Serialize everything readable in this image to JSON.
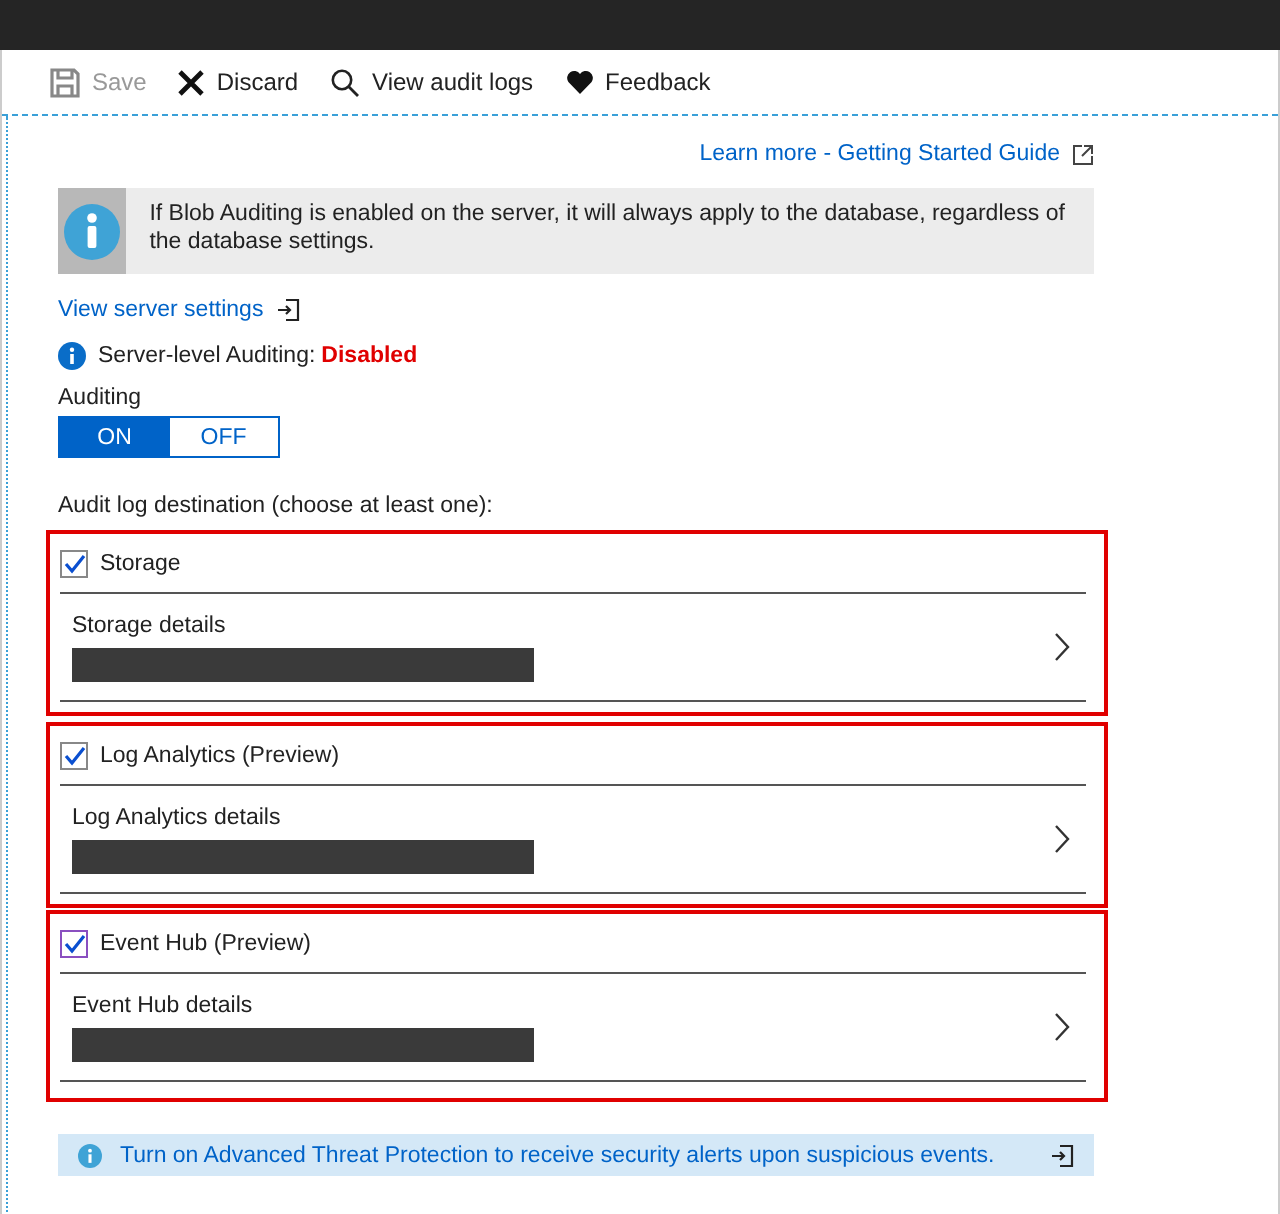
{
  "toolbar": [
    {
      "kind": "save",
      "label": "Save",
      "disabled": true
    },
    {
      "kind": "discard",
      "label": "Discard",
      "disabled": false
    },
    {
      "kind": "search",
      "label": "View audit logs",
      "disabled": false
    },
    {
      "kind": "feedback",
      "label": "Feedback",
      "disabled": false
    }
  ],
  "learn_more_link": "Learn more - Getting Started Guide",
  "info_box": "If Blob Auditing is enabled on the server, it will always apply to the database, regardless of the database settings.",
  "server_settings_link": "View server settings",
  "server_auditing": {
    "label": "Server-level Auditing:",
    "value": "Disabled"
  },
  "auditing": {
    "label": "Auditing",
    "options": [
      {
        "label": "ON",
        "selected": true
      },
      {
        "label": "OFF",
        "selected": false
      }
    ]
  },
  "destination_label": "Audit log destination (choose at least one):",
  "destinations": [
    {
      "label": "Storage",
      "checked": true,
      "details_label": "Storage details"
    },
    {
      "label": "Log Analytics (Preview)",
      "checked": true,
      "details_label": "Log Analytics details"
    },
    {
      "label": "Event Hub (Preview)",
      "checked": true,
      "details_label": "Event Hub details"
    }
  ],
  "threat_banner": "Turn on Advanced Threat Protection to receive security alerts upon suspicious events."
}
